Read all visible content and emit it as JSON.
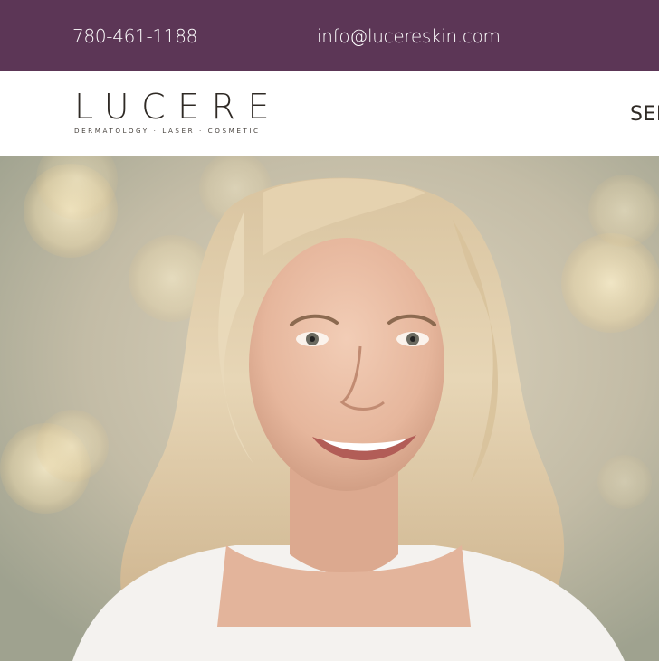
{
  "topbar": {
    "phone": "780-461-1188",
    "email": "info@lucereskin.com",
    "background": "#5c3656"
  },
  "header": {
    "logo": {
      "wordmark": "LUCERE",
      "tagline": "DERMATOLOGY · LASER · COSMETIC"
    },
    "nav": {
      "first_item_partial": "SEI"
    }
  },
  "hero": {
    "image": "smiling-woman-portrait",
    "background_style": "bokeh-lights"
  }
}
